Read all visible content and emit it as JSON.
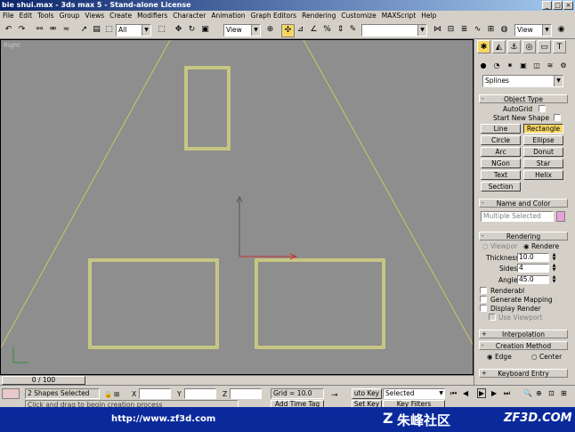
{
  "window": {
    "title": "bie shui.max - 3ds max 5 - Stand-alone License",
    "controls": [
      "_",
      "□",
      "×"
    ]
  },
  "menu": [
    "File",
    "Edit",
    "Tools",
    "Group",
    "Views",
    "Create",
    "Modifiers",
    "Character",
    "Animation",
    "Graph Editors",
    "Rendering",
    "Customize",
    "MAXScript",
    "Help"
  ],
  "toolbar": {
    "selection_filter": "All",
    "ref_coord": "View",
    "named_sel": "",
    "view_combo": "View"
  },
  "viewport": {
    "label": "Right"
  },
  "panel": {
    "category": "Splines",
    "object_type": {
      "title": "Object Type",
      "autogrid": "AutoGrid",
      "start_new_shape": "Start New Shape",
      "buttons": [
        "Line",
        "Rectangle",
        "Circle",
        "Ellipse",
        "Arc",
        "Donut",
        "NGon",
        "Star",
        "Text",
        "Helix",
        "Section"
      ],
      "active": "Rectangle"
    },
    "name_color": {
      "title": "Name and Color",
      "name_value": "Multiple Selected",
      "swatch": "#e8a0d8"
    },
    "rendering": {
      "title": "Rendering",
      "viewport_radio": "Viewpor",
      "renderer_radio": "Rendere",
      "thickness_label": "Thickness:",
      "thickness_value": "10.0",
      "sides_label": "Sides:",
      "sides_value": "4",
      "angle_label": "Angle:",
      "angle_value": "45.0",
      "renderable": "Renderabl",
      "gen_mapping": "Generate Mapping",
      "display_render": "Display Render",
      "use_viewport": "Use Viewport"
    },
    "interpolation": "Interpolation",
    "creation_method": {
      "title": "Creation Method",
      "edge": "Edge",
      "center": "Center"
    },
    "keyboard_entry": "Keyboard Entry"
  },
  "timeslider": {
    "frame": "0 / 100"
  },
  "status": {
    "selected": "2 Shapes Selected",
    "x_label": "X",
    "y_label": "Y",
    "z_label": "Z",
    "grid": "Grid = 10.0",
    "auto_key": "uto Key",
    "set_key": "Set Key",
    "selected_combo": "Selected",
    "key_filters": "Key Filters",
    "prompt": "Click and drag to begin creation process",
    "add_time_tag": "Add Time Tag"
  },
  "banner": {
    "url": "http://www.zf3d.com",
    "site_cn": "朱峰社区",
    "site_en": "ZF3D.COM"
  },
  "colors": {
    "viewport_bg": "#8e8e8e",
    "shape_yellow": "#ffff78",
    "active_button": "#f7d764",
    "banner": "#0a2a9c"
  }
}
